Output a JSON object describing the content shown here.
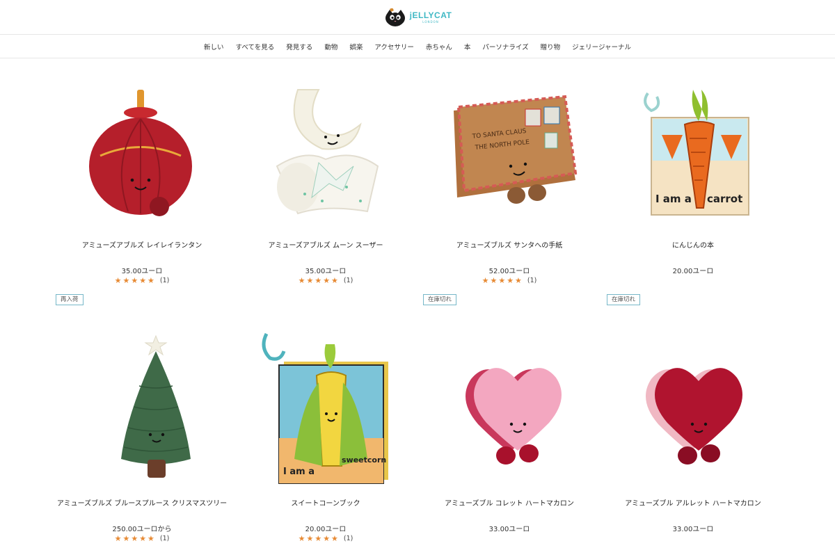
{
  "brand": {
    "name": "jELLYCAT",
    "sub": "LONDON"
  },
  "nav": [
    "新しい",
    "すべてを見る",
    "発見する",
    "動物",
    "娯楽",
    "アクセサリー",
    "赤ちゃん",
    "本",
    "パーソナライズ",
    "贈り物",
    "ジェリージャーナル"
  ],
  "products": [
    {
      "name": "アミューズアブルズ レイレイランタン",
      "price": "35.00ユーロ",
      "stars": "★★★★★",
      "count": "(1)",
      "badge": "",
      "image": "red-lantern-plush"
    },
    {
      "name": "アミューズアブルズ ムーン スーザー",
      "price": "35.00ユーロ",
      "stars": "★★★★★",
      "count": "(1)",
      "badge": "",
      "image": "moon-soother-plush"
    },
    {
      "name": "アミューズブルズ サンタへの手紙",
      "price": "52.00ユーロ",
      "stars": "★★★★★",
      "count": "(1)",
      "badge": "",
      "image": "santa-letter-plush",
      "letter_lines": [
        "TO SANTA CLAUS",
        "THE NORTH POLE"
      ]
    },
    {
      "name": "にんじんの本",
      "price": "20.00ユーロ",
      "stars": "",
      "count": "",
      "badge": "",
      "image": "carrot-book",
      "book_text": [
        "I am a",
        "carrot"
      ]
    },
    {
      "name": "アミューズブルズ ブルースプルース クリスマスツリー",
      "price": "250.00ユーロから",
      "stars": "★★★★★",
      "count": "(1)",
      "badge": "再入荷",
      "image": "christmas-tree-plush"
    },
    {
      "name": "スイートコーンブック",
      "price": "20.00ユーロ",
      "stars": "★★★★★",
      "count": "(1)",
      "badge": "",
      "image": "sweetcorn-book",
      "book_text": [
        "I am a",
        "sweetcorn"
      ]
    },
    {
      "name": "アミューズブル コレット ハートマカロン",
      "price": "33.00ユーロ",
      "stars": "",
      "count": "",
      "badge": "在庫切れ",
      "image": "pink-heart-macaron"
    },
    {
      "name": "アミューズブル アルレット ハートマカロン",
      "price": "33.00ユーロ",
      "stars": "",
      "count": "",
      "badge": "在庫切れ",
      "image": "red-heart-macaron"
    }
  ]
}
